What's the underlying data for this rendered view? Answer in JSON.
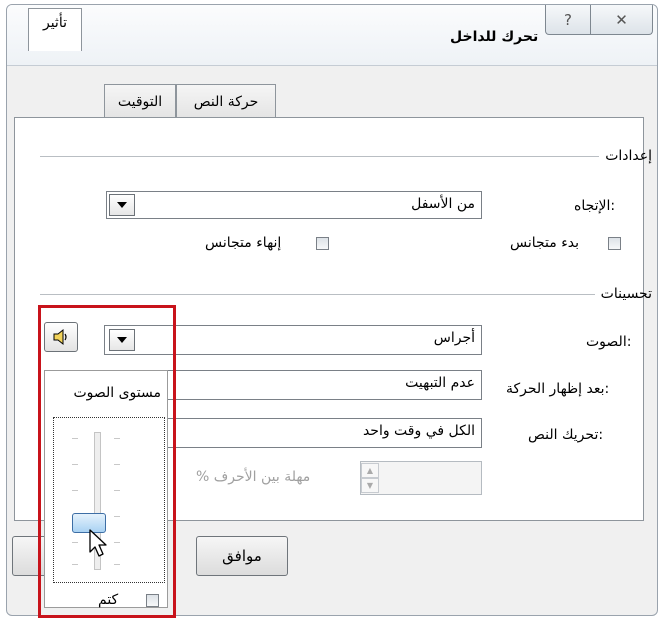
{
  "dialog": {
    "title": "تحرك للداخل",
    "help_glyph": "?",
    "close_glyph": "✕"
  },
  "tabs": [
    {
      "label": "تأثير",
      "active": true
    },
    {
      "label": "التوقيت",
      "active": false
    },
    {
      "label": "حركة النص",
      "active": false
    }
  ],
  "settings": {
    "section_label": "إعدادات",
    "direction_label": "الإتجاه:",
    "direction_value": "من الأسفل",
    "smooth_start_label": "بدء متجانس",
    "smooth_start_checked": false,
    "smooth_end_label": "إنهاء متجانس",
    "smooth_end_checked": false
  },
  "enhancements": {
    "section_label": "تحسينات",
    "sound_label": "الصوت:",
    "sound_value": "أجراس",
    "after_animation_label": "بعد إظهار الحركة:",
    "after_animation_value": "عدم التبهيت",
    "animate_text_label": "تحريك النص:",
    "animate_text_value": "الكل في وقت واحد",
    "delay_label": "% مهلة بين الأحرف",
    "delay_value": ""
  },
  "volume_popup": {
    "title": "مستوى الصوت",
    "level": 0.3,
    "mute_label": "كتم",
    "mute_checked": false
  },
  "footer": {
    "ok_label": "موافق"
  },
  "colors": {
    "highlight_frame": "#c8131b",
    "thumb": "#a9d2f3"
  }
}
